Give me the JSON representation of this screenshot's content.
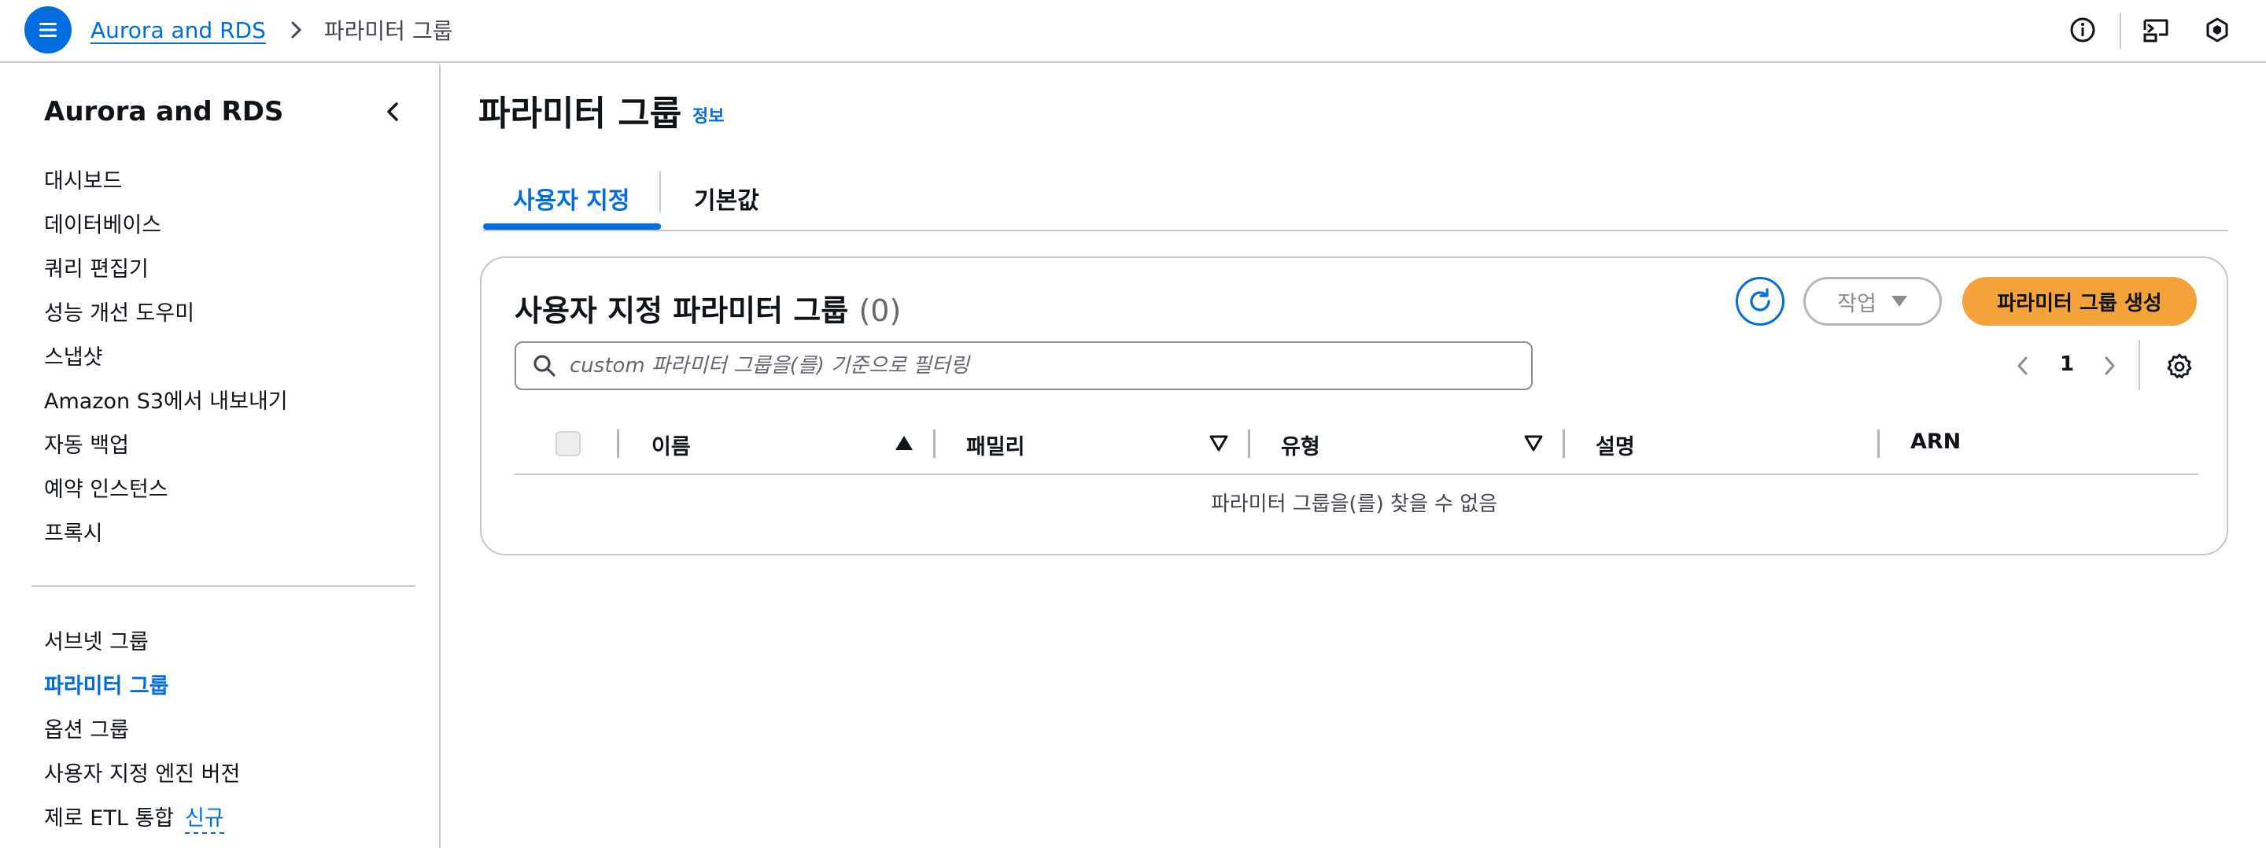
{
  "topbar": {
    "breadcrumb": [
      {
        "label": "Aurora and RDS"
      },
      {
        "label": "파라미터 그룹"
      }
    ]
  },
  "sidebar": {
    "title": "Aurora and RDS",
    "items_top": [
      {
        "label": "대시보드"
      },
      {
        "label": "데이터베이스"
      },
      {
        "label": "쿼리 편집기"
      },
      {
        "label": "성능 개선 도우미"
      },
      {
        "label": "스냅샷"
      },
      {
        "label": "Amazon S3에서 내보내기"
      },
      {
        "label": "자동 백업"
      },
      {
        "label": "예약 인스턴스"
      },
      {
        "label": "프록시"
      }
    ],
    "items_bottom": [
      {
        "label": "서브넷 그룹"
      },
      {
        "label": "파라미터 그룹",
        "active": true
      },
      {
        "label": "옵션 그룹"
      },
      {
        "label": "사용자 지정 엔진 버전"
      },
      {
        "label": "제로 ETL 통합",
        "badge": "신규"
      }
    ]
  },
  "main": {
    "title": "파라미터 그룹",
    "info_link": "정보",
    "tabs": [
      {
        "label": "사용자 지정",
        "active": true
      },
      {
        "label": "기본값"
      }
    ],
    "card": {
      "title": "사용자 지정 파라미터 그룹",
      "count": "(0)",
      "actions_label": "작업",
      "create_label": "파라미터 그룹 생성",
      "search_placeholder": "custom 파라미터 그룹을(를) 기준으로 필터링",
      "page_number": "1",
      "columns": [
        {
          "label": "이름",
          "sort": "ascending"
        },
        {
          "label": "패밀리",
          "sort": "sortable"
        },
        {
          "label": "유형",
          "sort": "sortable"
        },
        {
          "label": "설명"
        },
        {
          "label": "ARN"
        }
      ],
      "empty_message": "파라미터 그룹을(를) 찾을 수 없음"
    }
  },
  "colors": {
    "accent": "#006ce0",
    "primary_button": "#f4a23a",
    "border": "#c6c6cd",
    "text": "#0f141a"
  },
  "icons": {
    "menu": "hamburger-menu-icon",
    "breadcrumb_separator": "chevron-right-icon",
    "info": "info-icon",
    "cloudshell": "cloudshell-icon",
    "notifications": "hexagon-status-icon",
    "collapse": "chevron-left-icon",
    "refresh": "refresh-icon",
    "search": "search-icon",
    "settings": "gear-icon"
  }
}
